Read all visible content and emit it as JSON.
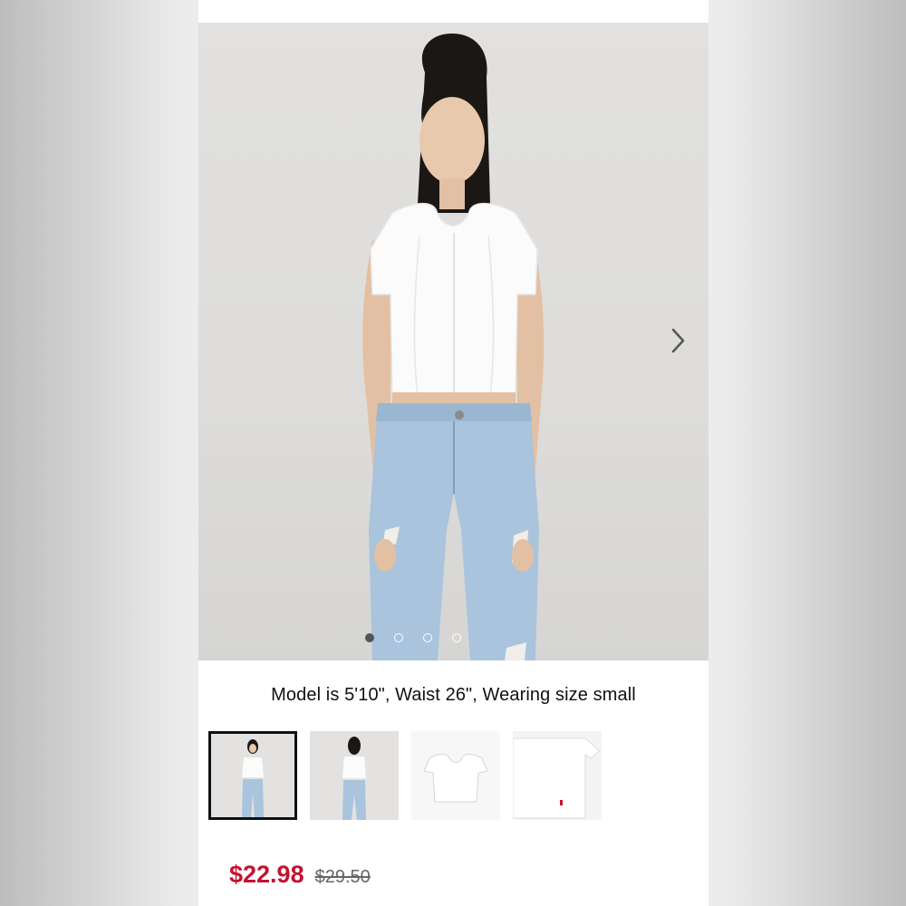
{
  "product": {
    "image_alt": "Model wearing white scoop-neck cropped tee with light-wash ripped jeans",
    "carousel": {
      "dot_count": 4,
      "active_index": 0,
      "next_icon": "chevron-right-icon"
    },
    "model_caption": "Model is 5'10\", Waist 26\", Wearing size small",
    "thumbnails": [
      {
        "kind": "model-front",
        "selected": true
      },
      {
        "kind": "model-back",
        "selected": false
      },
      {
        "kind": "flat-lay",
        "selected": false
      },
      {
        "kind": "detail",
        "selected": false
      }
    ],
    "price": {
      "sale": "$22.98",
      "original": "$29.50",
      "sale_color": "#c41230"
    }
  }
}
